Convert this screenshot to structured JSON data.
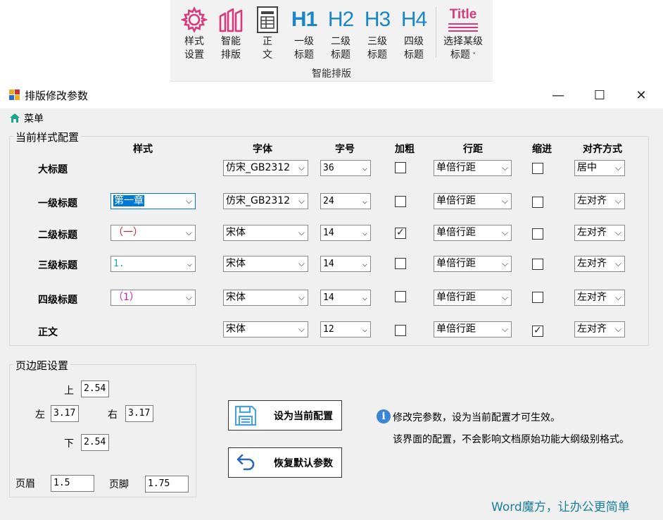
{
  "ribbon": {
    "buttons": [
      {
        "label1": "样式",
        "label2": "设置",
        "icon": "gear-icon"
      },
      {
        "label1": "智能",
        "label2": "排版",
        "icon": "columns-icon"
      },
      {
        "label1": "正",
        "label2": "文",
        "icon": "document-icon"
      },
      {
        "heading": "H1",
        "label1": "一级",
        "label2": "标题",
        "icon": "h1-icon"
      },
      {
        "heading": "H2",
        "label1": "二级",
        "label2": "标题",
        "icon": "h2-icon"
      },
      {
        "heading": "H3",
        "label1": "三级",
        "label2": "标题",
        "icon": "h3-icon"
      },
      {
        "heading": "H4",
        "label1": "四级",
        "label2": "标题",
        "icon": "h4-icon"
      },
      {
        "heading": "Title",
        "label1": "选择某级",
        "label2": "标题",
        "icon": "title-icon"
      }
    ],
    "group_label": "智能排版",
    "colors": {
      "accent_pink": "#d63a7c",
      "heading_blue": "#1a86c8"
    }
  },
  "window": {
    "title": "排版修改参数",
    "controls": {
      "minimize": "—",
      "maximize": "☐",
      "close": "✕"
    }
  },
  "menu": {
    "label": "菜单"
  },
  "style_config": {
    "title": "当前样式配置",
    "columns": [
      "样式",
      "字体",
      "字号",
      "加粗",
      "行距",
      "缩进",
      "对齐方式"
    ],
    "rows": [
      {
        "label": "大标题",
        "style": null,
        "font": "仿宋_GB2312",
        "size": "36",
        "bold": false,
        "spacing": "单倍行距",
        "indent": false,
        "align": "居中"
      },
      {
        "label": "一级标题",
        "style": "第一章",
        "style_color": "#ffffff",
        "font": "仿宋_GB2312",
        "size": "24",
        "bold": false,
        "spacing": "单倍行距",
        "indent": false,
        "align": "左对齐"
      },
      {
        "label": "二级标题",
        "style": "（一）",
        "style_color": "#d02020",
        "font": "宋体",
        "size": "14",
        "bold": true,
        "spacing": "单倍行距",
        "indent": false,
        "align": "左对齐"
      },
      {
        "label": "三级标题",
        "style": "1.",
        "style_color": "#1aa0b0",
        "font": "宋体",
        "size": "14",
        "bold": false,
        "spacing": "单倍行距",
        "indent": false,
        "align": "左对齐"
      },
      {
        "label": "四级标题",
        "style": "（1）",
        "style_color": "#d020b0",
        "font": "宋体",
        "size": "14",
        "bold": false,
        "spacing": "单倍行距",
        "indent": false,
        "align": "左对齐"
      },
      {
        "label": "正文",
        "style": null,
        "font": "宋体",
        "size": "12",
        "bold": false,
        "spacing": "单倍行距",
        "indent": true,
        "align": "左对齐"
      }
    ]
  },
  "margins": {
    "title": "页边距设置",
    "top_label": "上",
    "top": "2.54",
    "left_label": "左",
    "left": "3.17",
    "right_label": "右",
    "right": "3.17",
    "bottom_label": "下",
    "bottom": "2.54",
    "header_label": "页眉",
    "header": "1.5",
    "footer_label": "页脚",
    "footer": "1.75"
  },
  "actions": {
    "set_current": "设为当前配置",
    "restore_default": "恢复默认参数"
  },
  "info": {
    "icon_letter": "i",
    "line1": "修改完参数，设为当前配置才可生效。",
    "line2": "该界面的配置，不会影响文档原始功能大纲级别格式。"
  },
  "brand": "Word魔方，让办公更简单"
}
